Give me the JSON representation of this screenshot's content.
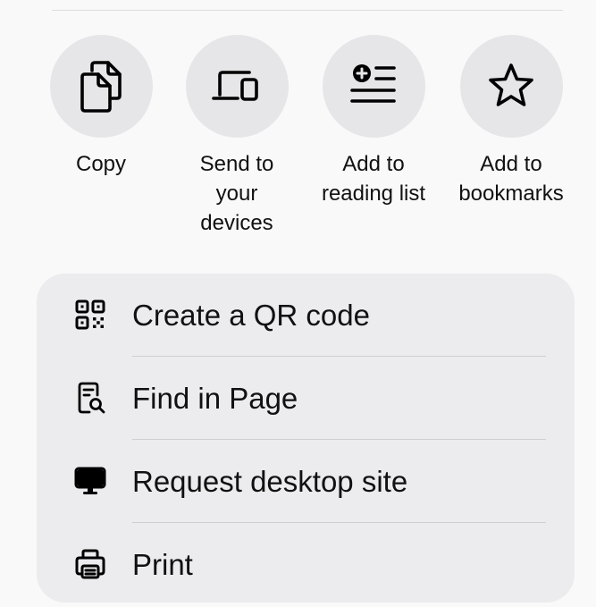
{
  "actions": [
    {
      "label": "Copy",
      "icon": "copy-icon"
    },
    {
      "label": "Send to\nyour\ndevices",
      "icon": "send-to-devices-icon"
    },
    {
      "label": "Add to\nreading list",
      "icon": "add-to-reading-list-icon"
    },
    {
      "label": "Add to\nbookmarks",
      "icon": "bookmark-star-icon"
    }
  ],
  "menu": {
    "items": [
      {
        "label": "Create a QR code",
        "icon": "qr-code-icon"
      },
      {
        "label": "Find in Page",
        "icon": "find-in-page-icon"
      },
      {
        "label": "Request desktop site",
        "icon": "desktop-icon"
      },
      {
        "label": "Print",
        "icon": "printer-icon"
      }
    ]
  },
  "colors": {
    "background": "#f9f9fa",
    "action_circle": "#e6e6e8",
    "menu_card": "#ececee",
    "divider": "#cfcfd3",
    "text": "#111111"
  }
}
